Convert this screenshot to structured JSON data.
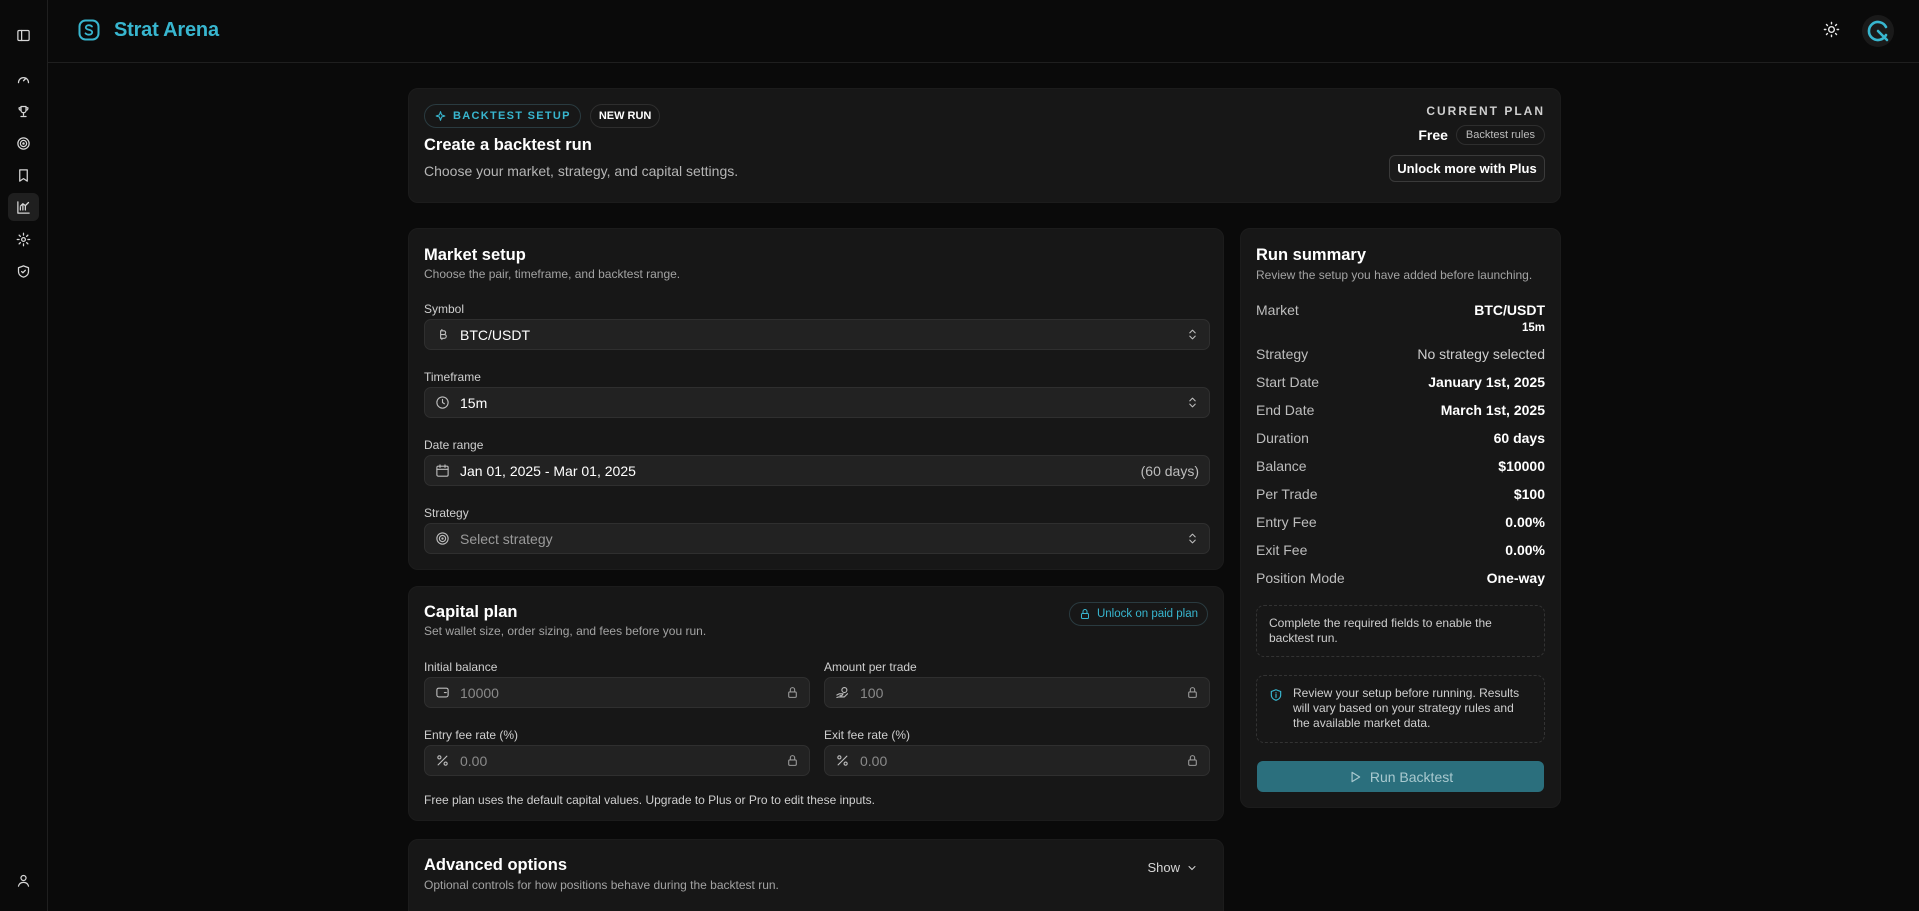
{
  "brand": {
    "name": "Strat Arena"
  },
  "header": {
    "theme_icon": "sun-icon",
    "avatar_icon": "user-avatar-icon"
  },
  "sidebar": {
    "items": [
      {
        "icon": "sidebar-toggle-icon"
      },
      {
        "icon": "gauge-icon"
      },
      {
        "icon": "trophy-icon"
      },
      {
        "icon": "target-icon"
      },
      {
        "icon": "bookmark-icon"
      },
      {
        "icon": "chart-icon"
      },
      {
        "icon": "settings-icon"
      },
      {
        "icon": "shield-check-icon"
      }
    ],
    "footer_icon": "user-icon"
  },
  "setup": {
    "badge": "BACKTEST SETUP",
    "new_run": "NEW RUN",
    "title": "Create a backtest run",
    "subtitle": "Choose your market, strategy, and capital settings.",
    "plan_label": "CURRENT PLAN",
    "plan_name": "Free",
    "plan_rules": "Backtest rules",
    "upgrade_button": "Unlock more with Plus"
  },
  "market": {
    "title": "Market setup",
    "subtitle": "Choose the pair, timeframe, and backtest range.",
    "symbol_label": "Symbol",
    "symbol_value": "BTC/USDT",
    "timeframe_label": "Timeframe",
    "timeframe_value": "15m",
    "date_label": "Date range",
    "date_value": "Jan 01, 2025 - Mar 01, 2025",
    "date_days": "(60 days)",
    "strategy_label": "Strategy",
    "strategy_placeholder": "Select strategy"
  },
  "capital": {
    "title": "Capital plan",
    "subtitle": "Set wallet size, order sizing, and fees before you run.",
    "unlock": "Unlock on paid plan",
    "initial_label": "Initial balance",
    "initial_value": "10000",
    "amount_label": "Amount per trade",
    "amount_value": "100",
    "entry_label": "Entry fee rate (%)",
    "entry_value": "0.00",
    "exit_label": "Exit fee rate (%)",
    "exit_value": "0.00",
    "note": "Free plan uses the default capital values. Upgrade to Plus or Pro to edit these inputs."
  },
  "advanced": {
    "title": "Advanced options",
    "subtitle": "Optional controls for how positions behave during the backtest run.",
    "toggle": "Show"
  },
  "summary": {
    "title": "Run summary",
    "subtitle": "Review the setup you have added before launching.",
    "market_k": "Market",
    "market_v": "BTC/USDT",
    "market_tf": "15m",
    "rows": [
      {
        "k": "Strategy",
        "v": "No strategy selected"
      },
      {
        "k": "Start Date",
        "v": "January 1st, 2025"
      },
      {
        "k": "End Date",
        "v": "March 1st, 2025"
      },
      {
        "k": "Duration",
        "v": "60 days"
      },
      {
        "k": "Balance",
        "v": "$10000"
      },
      {
        "k": "Per Trade",
        "v": "$100"
      },
      {
        "k": "Entry Fee",
        "v": "0.00%"
      },
      {
        "k": "Exit Fee",
        "v": "0.00%"
      },
      {
        "k": "Position Mode",
        "v": "One-way"
      }
    ],
    "required_note": "Complete the required fields to enable the backtest run.",
    "review_note": "Review your setup before running. Results will vary based on your strategy rules and the available market data.",
    "run_button": "Run Backtest"
  },
  "colors": {
    "accent": "#38b6cf",
    "run_button": "#2b6f7d",
    "background": "#0a0a0a",
    "card": "#171717"
  }
}
